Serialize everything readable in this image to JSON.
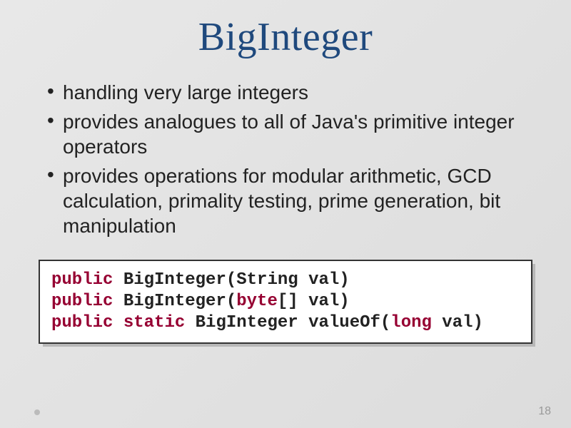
{
  "title": "BigInteger",
  "bullets": [
    "handling very large integers",
    "provides analogues to all of Java's primitive integer operators",
    "provides operations for modular arithmetic, GCD calculation, primality testing, prime generation, bit manipulation"
  ],
  "code": {
    "lines": [
      {
        "tokens": [
          {
            "t": "public",
            "kw": true
          },
          {
            "t": " BigInteger(String val)",
            "kw": false
          }
        ]
      },
      {
        "tokens": [
          {
            "t": "public",
            "kw": true
          },
          {
            "t": " BigInteger(",
            "kw": false
          },
          {
            "t": "byte",
            "kw": true
          },
          {
            "t": "[] val)",
            "kw": false
          }
        ]
      },
      {
        "tokens": [
          {
            "t": "public",
            "kw": true
          },
          {
            "t": " ",
            "kw": false
          },
          {
            "t": "static",
            "kw": true
          },
          {
            "t": " BigInteger valueOf(",
            "kw": false
          },
          {
            "t": "long",
            "kw": true
          },
          {
            "t": " val)",
            "kw": false
          }
        ]
      }
    ]
  },
  "page_number": "18"
}
